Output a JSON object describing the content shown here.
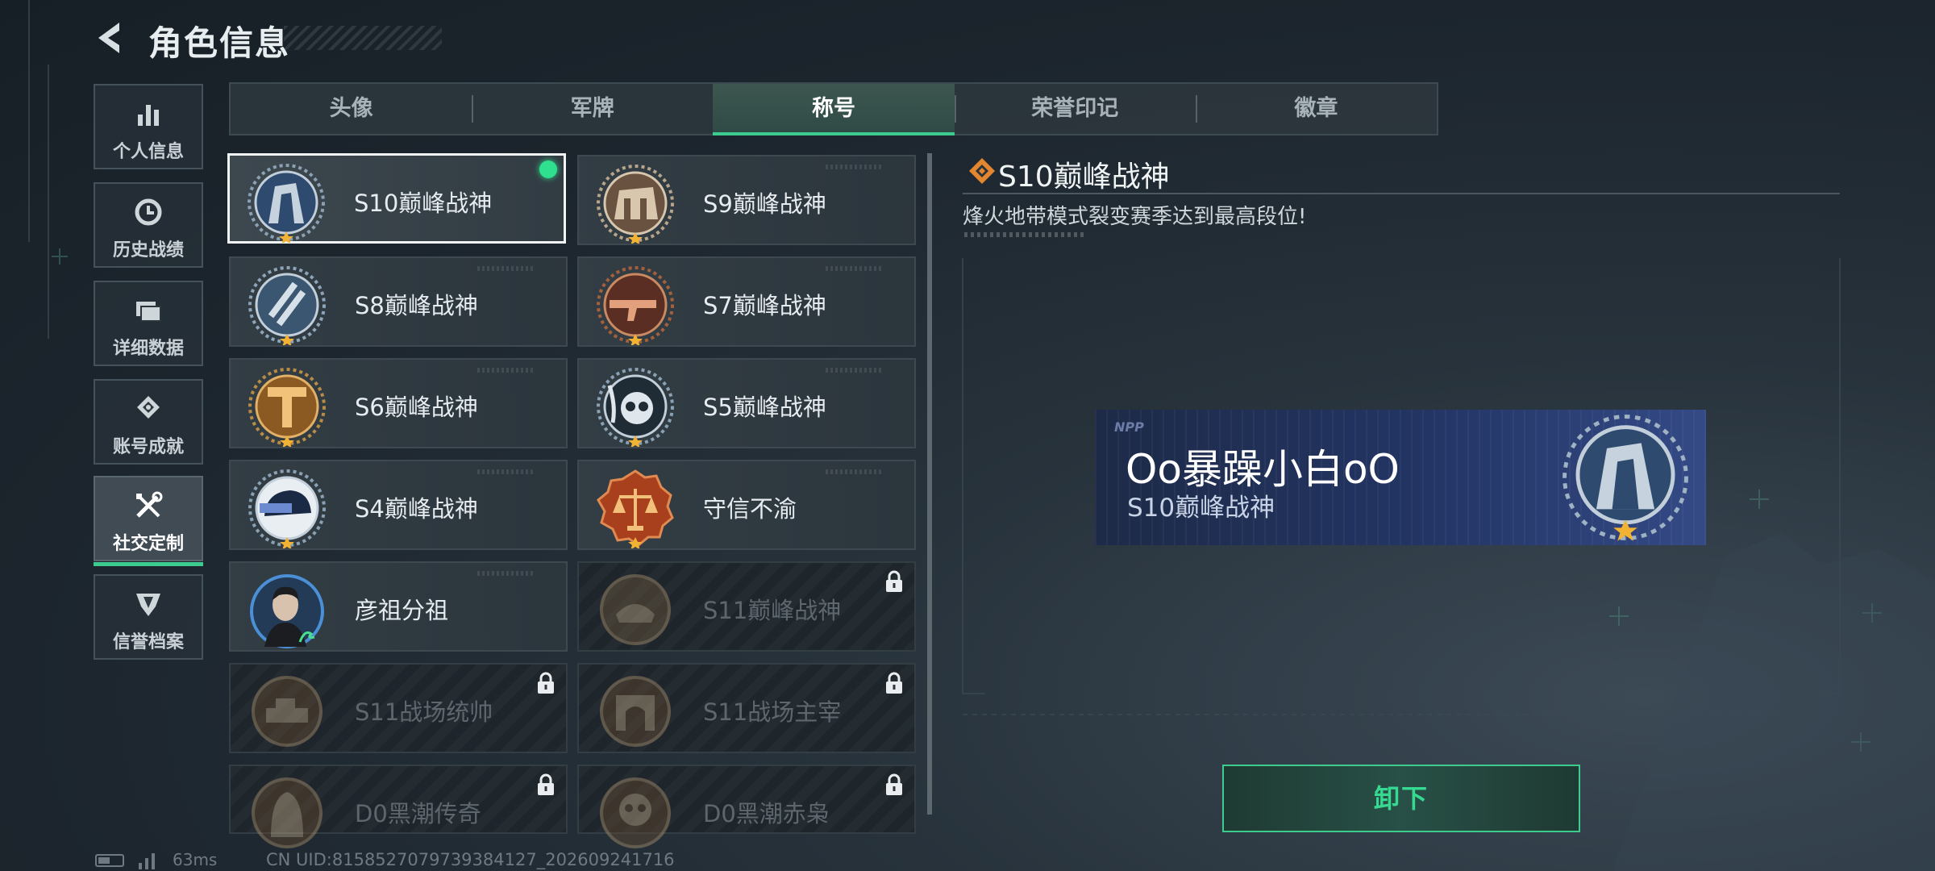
{
  "header": {
    "title": "角色信息"
  },
  "sidebar": {
    "items": [
      {
        "label": "个人信息",
        "icon": "bar-chart-icon"
      },
      {
        "label": "历史战绩",
        "icon": "clock-icon"
      },
      {
        "label": "详细数据",
        "icon": "folder-icon"
      },
      {
        "label": "账号成就",
        "icon": "achievement-icon"
      },
      {
        "label": "社交定制",
        "icon": "tools-icon",
        "active": true
      },
      {
        "label": "信誉档案",
        "icon": "shield-badge-icon"
      }
    ]
  },
  "tabs": [
    {
      "label": "头像"
    },
    {
      "label": "军牌"
    },
    {
      "label": "称号",
      "active": true
    },
    {
      "label": "荣誉印记"
    },
    {
      "label": "徽章"
    }
  ],
  "titles": [
    {
      "name": "S10巅峰战神",
      "selected": true,
      "equipped": true,
      "locked": false
    },
    {
      "name": "S9巅峰战神",
      "locked": false
    },
    {
      "name": "S8巅峰战神",
      "locked": false
    },
    {
      "name": "S7巅峰战神",
      "locked": false
    },
    {
      "name": "S6巅峰战神",
      "locked": false
    },
    {
      "name": "S5巅峰战神",
      "locked": false
    },
    {
      "name": "S4巅峰战神",
      "locked": false
    },
    {
      "name": "守信不渝",
      "locked": false
    },
    {
      "name": "彦祖分祖",
      "locked": false
    },
    {
      "name": "S11巅峰战神",
      "locked": true
    },
    {
      "name": "S11战场统帅",
      "locked": true
    },
    {
      "name": "S11战场主宰",
      "locked": true
    },
    {
      "name": "D0黑潮传奇",
      "locked": true
    },
    {
      "name": "D0黑潮赤枭",
      "locked": true
    }
  ],
  "detail": {
    "title": "S10巅峰战神",
    "description": "烽火地带模式裂变赛季达到最高段位!"
  },
  "namecard": {
    "logo": "NPP",
    "username": "Oo暴躁小白oO",
    "title": "S10巅峰战神"
  },
  "actions": {
    "unequip": "卸下"
  },
  "status": {
    "ping": "63ms",
    "uid": "CN UID:8158527079739384127_202609241716"
  },
  "colors": {
    "accent": "#3ccc8f",
    "equipped_dot": "#2fe08e",
    "star": "#f2b233"
  }
}
